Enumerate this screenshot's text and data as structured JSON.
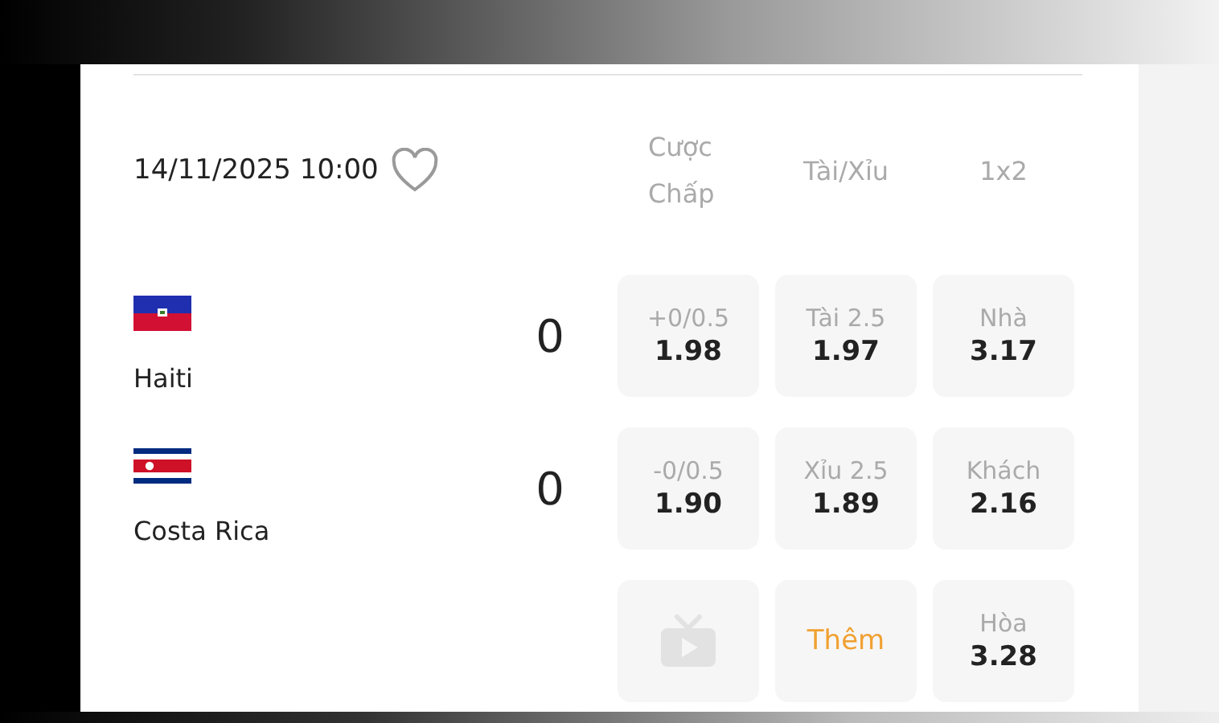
{
  "match": {
    "datetime": "14/11/2025 10:00",
    "favorite": false
  },
  "columns": [
    "Cược Chấp",
    "Tài/Xỉu",
    "1x2"
  ],
  "teams": [
    {
      "name": "Haiti",
      "score": "0"
    },
    {
      "name": "Costa Rica",
      "score": "0"
    }
  ],
  "odds": [
    [
      {
        "kind": "odd",
        "label": "+0/0.5",
        "value": "1.98"
      },
      {
        "kind": "odd",
        "label": "Tài 2.5",
        "value": "1.97"
      },
      {
        "kind": "odd",
        "label": "Nhà",
        "value": "3.17"
      }
    ],
    [
      {
        "kind": "odd",
        "label": "-0/0.5",
        "value": "1.90"
      },
      {
        "kind": "odd",
        "label": "Xỉu 2.5",
        "value": "1.89"
      },
      {
        "kind": "odd",
        "label": "Khách",
        "value": "2.16"
      }
    ],
    [
      {
        "kind": "tv"
      },
      {
        "kind": "more",
        "label": "Thêm"
      },
      {
        "kind": "odd",
        "label": "Hòa",
        "value": "3.28"
      }
    ]
  ]
}
